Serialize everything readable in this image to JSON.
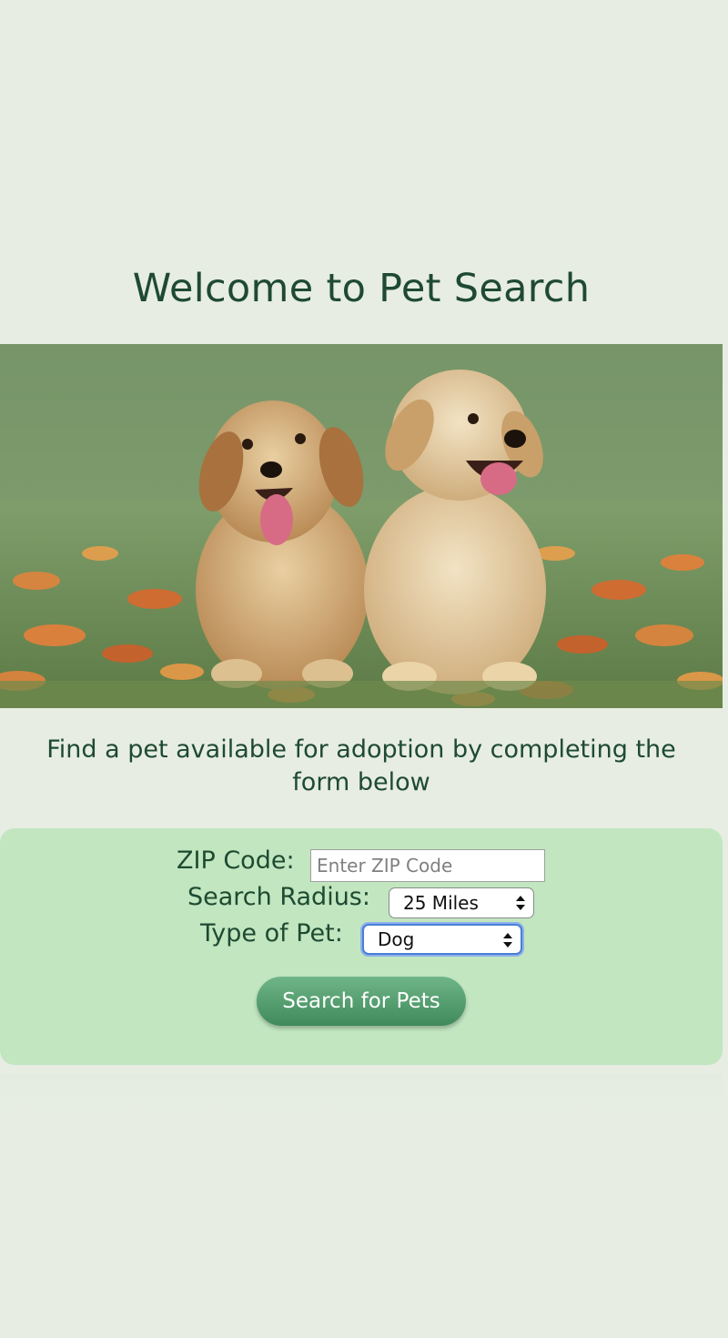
{
  "page": {
    "title": "Welcome to Pet Search",
    "intro": "Find a pet available for adoption by completing the form below"
  },
  "hero_image": {
    "description_icon": "puppies-photo"
  },
  "form": {
    "zip_label": "ZIP Code:",
    "zip_placeholder": "Enter ZIP Code",
    "zip_value": "",
    "radius_label": "Search Radius:",
    "radius_selected": "25 Miles",
    "pet_type_label": "Type of Pet:",
    "pet_type_selected": "Dog",
    "submit_label": "Search for Pets"
  },
  "colors": {
    "background": "#e7ede2",
    "heading": "#1e4a31",
    "form_panel": "#c1e6c0",
    "button": "#4f9a6b",
    "focus_ring": "#4a7fd6"
  }
}
